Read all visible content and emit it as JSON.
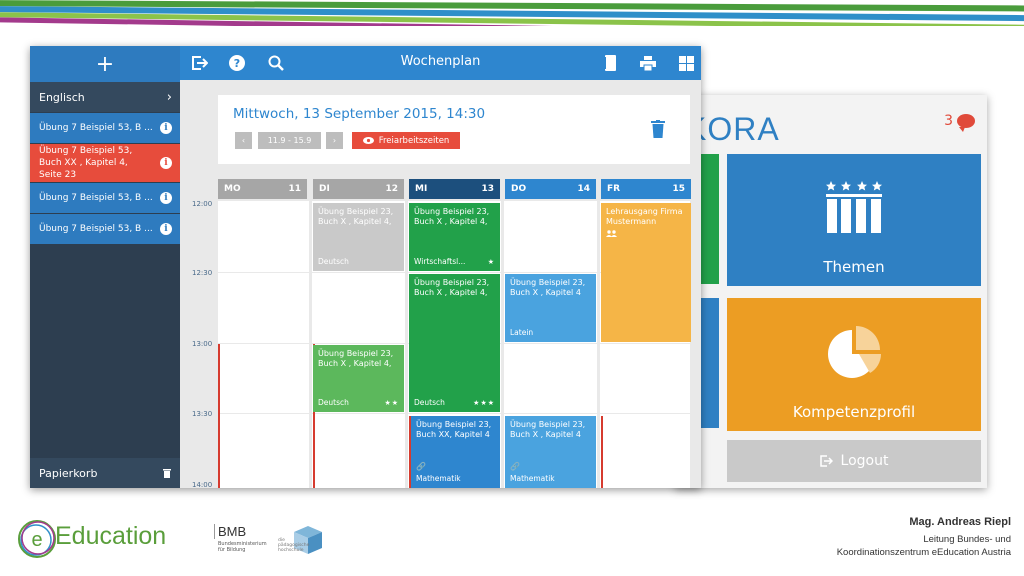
{
  "kora": {
    "logo": "KORA",
    "badge_count": "3",
    "tiles": {
      "themen": "Themen",
      "kompetenz": "Kompetenzprofil",
      "logout": "Logout"
    }
  },
  "app": {
    "sidebar": {
      "add": "+",
      "subject": "Englisch",
      "items": [
        "Übung 7 Beispiel 53, B ...",
        "Übung 7 Beispiel 53, Buch XX , Kapitel 4, Seite 23",
        "Übung 7 Beispiel 53, B ...",
        "Übung 7 Beispiel 53, B ..."
      ],
      "trash": "Papierkorb"
    },
    "topbar": {
      "title": "Wochenplan"
    },
    "header": {
      "date": "Mittwoch, 13 September 2015, 14:30",
      "prev": "‹",
      "range": "11.9 - 15.9",
      "next": "›",
      "free_time": "Freiarbeitszeiten"
    },
    "days": [
      {
        "name": "MO",
        "num": "11",
        "color": "#a6a6a6"
      },
      {
        "name": "DI",
        "num": "12",
        "color": "#a6a6a6"
      },
      {
        "name": "MI",
        "num": "13",
        "color": "#1c4f7d"
      },
      {
        "name": "DO",
        "num": "14",
        "color": "#2e86cf"
      },
      {
        "name": "FR",
        "num": "15",
        "color": "#2e86cf"
      }
    ],
    "times": [
      "12:00",
      "12:30",
      "13:00",
      "13:30",
      "14:00"
    ],
    "events": {
      "di1": {
        "title": "Übung Beispiel 23, Buch X , Kapitel 4,",
        "sub": "Deutsch"
      },
      "di2": {
        "title": "Übung Beispiel 23, Buch X , Kapitel 4,",
        "sub": "Deutsch",
        "stars": "★★"
      },
      "mi1": {
        "title": "Übung Beispiel 23, Buch X , Kapitel 4,",
        "sub": "Wirtschaftsl...",
        "stars": "★"
      },
      "mi2": {
        "title": "Übung Beispiel 23, Buch X , Kapitel 4,",
        "sub": "Deutsch",
        "stars": "★★★"
      },
      "mi3": {
        "title": "Übung Beispiel 23, Buch XX, Kapitel 4",
        "sub": "Mathematik"
      },
      "do1": {
        "title": "Übung Beispiel 23, Buch X , Kapitel 4",
        "sub": "Latein"
      },
      "do2": {
        "title": "Übung Beispiel 23, Buch X , Kapitel 4",
        "sub": "Mathematik"
      },
      "fr1": {
        "title": "Lehrausgang Firma Mustermann"
      }
    }
  },
  "footer": {
    "logo_text": "Education",
    "bmb": "BMB",
    "bmb_sub": "Bundesministerium für Bildung",
    "ph_text": "die pädagogische hochschule",
    "author_name": "Mag. Andreas Riepl",
    "author_role_1": "Leitung Bundes- und",
    "author_role_2": "Koordinationszentrum eEducation Austria"
  },
  "colors": {
    "blue": "#2e86cf",
    "dark_blue": "#1c4f7d",
    "red": "#e74c3c",
    "green": "#22a14a",
    "light_green": "#5cb85c",
    "orange": "#f5b547",
    "gray": "#bdbdbd"
  }
}
